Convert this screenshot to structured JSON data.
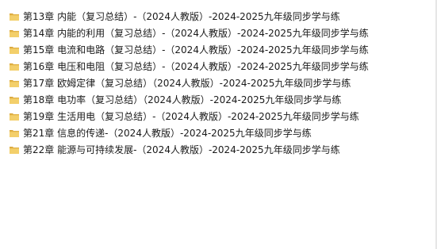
{
  "files": [
    {
      "name": "第13章  内能（复习总结）-（2024人教版）-2024-2025九年级同步学与练",
      "icon": "folder-icon"
    },
    {
      "name": "第14章  内能的利用（复习总结）-（2024人教版）-2024-2025九年级同步学与练",
      "icon": "folder-icon"
    },
    {
      "name": "第15章  电流和电路（复习总结）-（2024人教版）-2024-2025九年级同步学与练",
      "icon": "folder-icon"
    },
    {
      "name": "第16章  电压和电阻（复习总结）-（2024人教版）-2024-2025九年级同步学与练",
      "icon": "folder-icon"
    },
    {
      "name": "第17章  欧姆定律（复习总结）（2024人教版）-2024-2025九年级同步学与练",
      "icon": "folder-icon"
    },
    {
      "name": "第18章  电功率（复习总结）（2024人教版）-2024-2025九年级同步学与练",
      "icon": "folder-icon"
    },
    {
      "name": "第19章  生活用电（复习总结）-（2024人教版）-2024-2025九年级同步学与练",
      "icon": "folder-icon"
    },
    {
      "name": "第21章 信息的传递-（2024人教版）-2024-2025九年级同步学与练",
      "icon": "folder-icon"
    },
    {
      "name": "第22章 能源与可持续发展-（2024人教版）-2024-2025九年级同步学与练",
      "icon": "folder-icon"
    }
  ],
  "colors": {
    "folder_back": "#d9a63a",
    "folder_front": "#f3cf6a",
    "text": "#1a1a1a",
    "background": "#ffffff"
  }
}
